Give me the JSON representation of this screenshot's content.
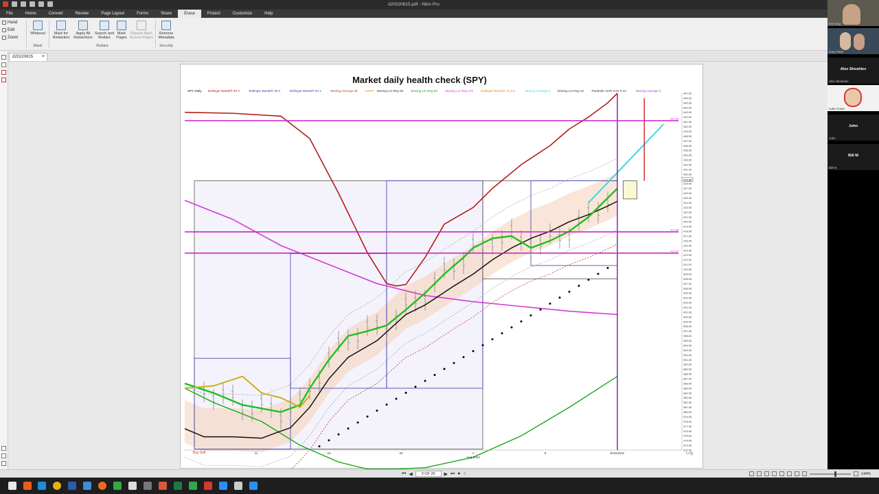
{
  "window": {
    "title": "d20220815.pdf - Nitro Pro"
  },
  "menu": {
    "tabs": [
      "File",
      "Home",
      "Convert",
      "Review",
      "Page Layout",
      "Forms",
      "Share",
      "Erase",
      "Protect",
      "Customize",
      "Help"
    ],
    "active_tab": "Erase"
  },
  "ribbon": {
    "modes": [
      "Hand",
      "Edit",
      "Zoom"
    ],
    "buttons": {
      "whiteout": "Whiteout",
      "mark_for_redaction": "Mark for Redaction",
      "apply_all_redactions": "Apply All Redactions",
      "search_and_redact": "Search and Redact",
      "mark_pages": "Mark Pages",
      "repeat_mark": "Repeat Mark Across Pages",
      "remove_metadata": "Remove Metadata"
    },
    "groups": {
      "mask": "Mask",
      "redact": "Redact",
      "security": "Security"
    }
  },
  "document_tab": {
    "name": "d20220815"
  },
  "chart_data": {
    "type": "line",
    "title": "Market daily health check (SPY)",
    "legend": [
      "SPY Daily",
      "Bollinger Bands® 30 3",
      "Bollinger Bands® 30 2",
      "Bollinger Bands® 30 1",
      "Moving Average 30",
      "VWAP",
      "Moving Lin Reg 30",
      "Moving Lin Reg 90",
      "Moving Lin Reg 270",
      "Bollinger Bands® 10 0.5",
      "Moving Average 5",
      "Moving Lin Reg 10",
      "Parabolic SAR 0.02 0.12",
      "Moving Average 3"
    ],
    "x_tick_labels": [
      "11",
      "18",
      "25",
      "1",
      "8",
      "8/15/2022"
    ],
    "x_month_label": "Aug 2022",
    "y_range": [
      372,
      447
    ],
    "y_tick_labels": [
      "447.00",
      "446.00",
      "445.00",
      "444.00",
      "443.00",
      "442.00",
      "441.00",
      "440.00",
      "439.00",
      "438.00",
      "437.00",
      "436.00",
      "435.00",
      "434.00",
      "433.00",
      "432.00",
      "431.00",
      "430.00",
      "429.00",
      "428.00",
      "427.00",
      "426.00",
      "425.00",
      "424.00",
      "423.00",
      "422.00",
      "421.00",
      "420.00",
      "419.00",
      "418.00",
      "417.00",
      "416.00",
      "415.00",
      "414.00",
      "413.00",
      "412.00",
      "411.00",
      "410.00",
      "409.00",
      "408.00",
      "407.00",
      "406.00",
      "405.00",
      "404.00",
      "403.00",
      "402.00",
      "401.00",
      "400.00",
      "399.00",
      "398.00",
      "397.00",
      "396.00",
      "395.00",
      "394.00",
      "393.00",
      "392.00",
      "391.00",
      "390.00",
      "389.00",
      "388.00",
      "387.00",
      "386.00",
      "385.00",
      "384.00",
      "383.00",
      "382.00",
      "381.00",
      "380.00",
      "379.00",
      "378.00",
      "377.00",
      "376.00",
      "375.00",
      "374.00",
      "373.00",
      "372.00"
    ],
    "horizontal_levels": [
      {
        "value": 441.25,
        "label": "441.25"
      },
      {
        "value": 417.88,
        "label": "417.88"
      },
      {
        "value": 413.41,
        "label": "413.41"
      }
    ],
    "price_marker": "428.86",
    "footer_labels": {
      "buy": "Buy",
      "sell": "Sell",
      "log": "Log"
    },
    "colors": {
      "bb3": "#b01c1c",
      "lin270": "#d23cd2",
      "lin90": "#18a818",
      "ma30": "#111111",
      "sar": "#000000",
      "ma3": "#7a1aa0",
      "reg10": "#38d8e8",
      "band_fill": "#f6d2b8",
      "level": "#cc22cc"
    },
    "series": [
      {
        "name": "Bollinger Bands® 30 3",
        "x": [
          0,
          5,
          10,
          13,
          16,
          19,
          21,
          22,
          23,
          25,
          27,
          30,
          32,
          35,
          38,
          40,
          42,
          44,
          45
        ],
        "y": [
          443.0,
          442.8,
          442.2,
          437.5,
          426.0,
          413.5,
          407.0,
          406.5,
          406.8,
          412.5,
          419.5,
          423.0,
          427.0,
          432.0,
          436.0,
          439.5,
          442.0,
          445.0,
          447.0
        ]
      },
      {
        "name": "Moving Lin Reg 270",
        "x": [
          0,
          5,
          10,
          15,
          20,
          25,
          30,
          35,
          40,
          45
        ],
        "y": [
          424.5,
          420.5,
          415.0,
          411.0,
          407.0,
          404.5,
          403.2,
          402.2,
          401.2,
          400.5
        ]
      },
      {
        "name": "Moving Lin Reg 90",
        "x": [
          0,
          3,
          8,
          12,
          16,
          19,
          22,
          25,
          30,
          35,
          40,
          45
        ],
        "y": [
          385.0,
          382.0,
          378.0,
          373.0,
          369.5,
          368.0,
          368.0,
          368.3,
          370.5,
          375.0,
          381.0,
          387.5
        ]
      },
      {
        "name": "Moving Average 30",
        "x": [
          0,
          2,
          5,
          8,
          10,
          11,
          13,
          15,
          17,
          20,
          23,
          25,
          28,
          30,
          32,
          34,
          36,
          38,
          40,
          42,
          44,
          45
        ],
        "y": [
          376.5,
          374.8,
          374.8,
          374.5,
          376.0,
          376.7,
          381.0,
          387.0,
          391.5,
          395.0,
          400.5,
          402.5,
          406.5,
          409.0,
          412.0,
          414.5,
          416.5,
          418.0,
          420.0,
          421.5,
          423.3,
          424.3
        ]
      },
      {
        "name": "Moving Lin Reg 30",
        "x": [
          0,
          3,
          6,
          10,
          12,
          13,
          15,
          17,
          19,
          21,
          23,
          25,
          27,
          29,
          30,
          32,
          34,
          36,
          38,
          40,
          42,
          44,
          45
        ],
        "y": [
          386.0,
          384.0,
          381.5,
          380.0,
          381.5,
          385.0,
          391.0,
          396.0,
          397.0,
          398.2,
          401.5,
          405.0,
          409.0,
          412.5,
          414.5,
          416.5,
          417.0,
          414.5,
          416.0,
          418.0,
          421.0,
          425.0,
          427.0
        ]
      },
      {
        "name": "Moving Average 3",
        "x": [
          0,
          3,
          6,
          8,
          10,
          12,
          13
        ],
        "y": [
          385.0,
          385.5,
          387.5,
          384.0,
          383.0,
          381.0,
          383.5
        ]
      }
    ]
  },
  "status_bar": {
    "page_indicator": "3 OF 29",
    "zoom": "144%"
  },
  "participants": [
    {
      "name": "ken long"
    },
    {
      "name": "Gary Pattn"
    },
    {
      "name": "Alex Shoshiev"
    },
    {
      "name": "Luke Cross"
    },
    {
      "name": "John"
    },
    {
      "name": "Bill M"
    }
  ]
}
